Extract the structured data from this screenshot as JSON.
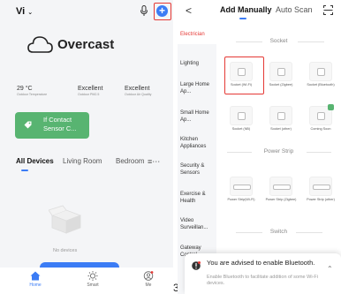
{
  "left_app": {
    "home_name": "Vi",
    "weather": {
      "condition": "Overcast",
      "stats": [
        {
          "value": "29 °C",
          "label": "Outdoor Temperature"
        },
        {
          "value": "Excellent",
          "label": "Outdoor PM2.5"
        },
        {
          "value": "Excellent",
          "label": "Outdoor Air Quality"
        }
      ]
    },
    "scene_card": {
      "label_line1": "If Contact",
      "label_line2": "Sensor C..."
    },
    "room_tabs": [
      "All Devices",
      "Living Room",
      "Bedroom"
    ],
    "empty_text": "No devices",
    "bottom_nav": [
      {
        "label": "Home",
        "icon": "home-icon"
      },
      {
        "label": "Smart",
        "icon": "smart-icon"
      },
      {
        "label": "Me",
        "icon": "me-icon"
      }
    ]
  },
  "step_number": "3",
  "right_app": {
    "back_glyph": "<",
    "tabs": {
      "manual": "Add Manually",
      "auto": "Auto Scan"
    },
    "categories": [
      "Electrician",
      "Lighting",
      "Large Home Ap...",
      "Small Home Ap...",
      "Kitchen Appliances",
      "Security & Sensors",
      "Exercise & Health",
      "Video Surveillan...",
      "Gateway Control"
    ],
    "sections": {
      "socket": {
        "title": "Socket",
        "items": [
          "Socket (Wi-Fi)",
          "Socket (Zigbee)",
          "Socket (Bluetooth)",
          "Socket (NB)",
          "Socket (other)",
          "Coming Soon"
        ]
      },
      "power_strip": {
        "title": "Power Strip",
        "items": [
          "Power Strip(Wi-Fi)",
          "Power Strip (Zigbee)",
          "Power Strip (other)"
        ]
      },
      "switch": {
        "title": "Switch"
      }
    },
    "toast": {
      "title": "You are advised to enable Bluetooth.",
      "body": "Enable Bluetooth to facilitate addition of some Wi-Fi devices."
    }
  },
  "colors": {
    "accent": "#3b7cf5",
    "highlight": "#e53935",
    "scene_green": "#58b471"
  }
}
